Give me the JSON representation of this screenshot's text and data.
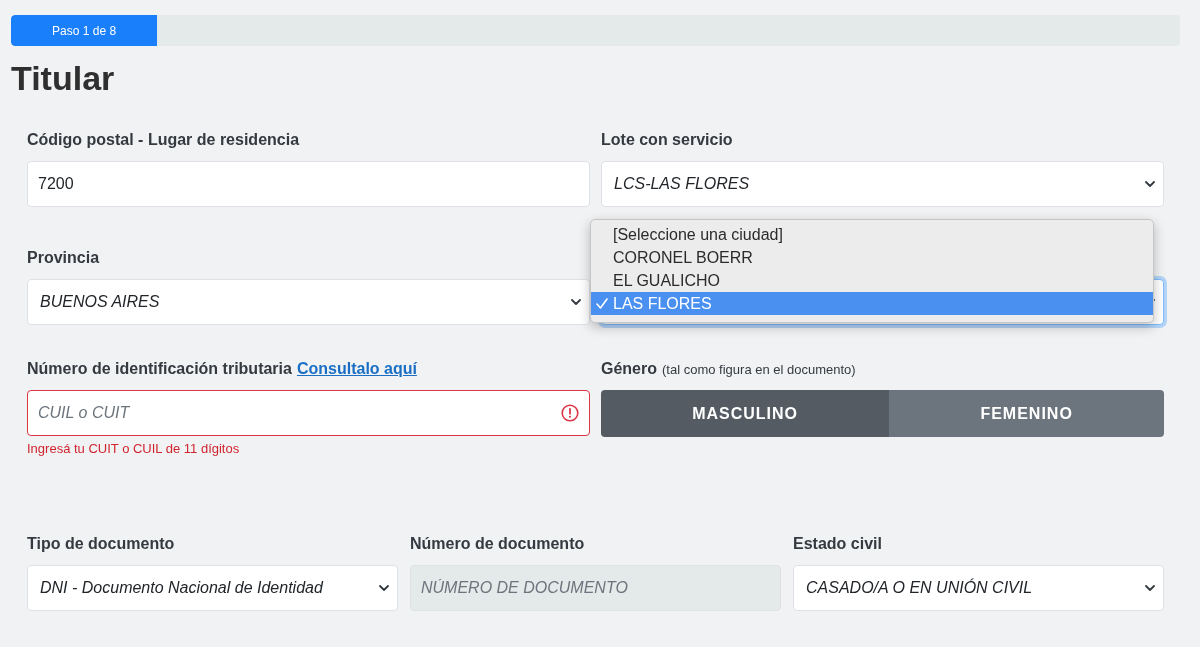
{
  "progress": {
    "label": "Paso 1 de 8",
    "level": 0.125
  },
  "title": "Titular",
  "rows": [
    {
      "fields": [
        {
          "kind": "text",
          "label": "Código postal - Lugar de residencia",
          "value": "7200"
        },
        {
          "kind": "select",
          "label": "Lote con servicio",
          "value": "LCS-LAS FLORES"
        }
      ]
    },
    {
      "fields": [
        {
          "kind": "select",
          "label": "Provincia",
          "value": "BUENOS AIRES"
        },
        {
          "kind": "select",
          "focused": true,
          "expanded": true,
          "options": [
            {
              "label": "[Seleccione una ciudad]",
              "selected": false
            },
            {
              "label": "CORONEL BOERR",
              "selected": false
            },
            {
              "label": "EL GUALICHO",
              "selected": false
            },
            {
              "label": "LAS FLORES",
              "selected": true
            }
          ]
        }
      ]
    },
    {
      "fields": [
        {
          "kind": "text",
          "label": "Número de identificación tributaria",
          "link": "Consultalo aquí",
          "placeholder": "CUIL o CUIT",
          "invalid": true,
          "error": "Ingresá tu CUIT o CUIL de 11 dígitos"
        },
        {
          "kind": "toggle",
          "label": "Género",
          "hint": "(tal como figura en el documento)",
          "options": [
            {
              "label": "MASCULINO",
              "selected": true
            },
            {
              "label": "FEMENINO",
              "selected": false
            }
          ]
        }
      ]
    },
    {
      "fields": [
        {
          "kind": "select",
          "label": "Tipo de documento",
          "value": "DNI - Documento Nacional de Identidad"
        },
        {
          "kind": "text",
          "label": "Número de documento",
          "placeholder": "NÚMERO DE DOCUMENTO",
          "disabled": true
        },
        {
          "kind": "select",
          "label": "Estado civil",
          "value": "CASADO/A O EN UNIÓN CIVIL"
        }
      ]
    }
  ]
}
